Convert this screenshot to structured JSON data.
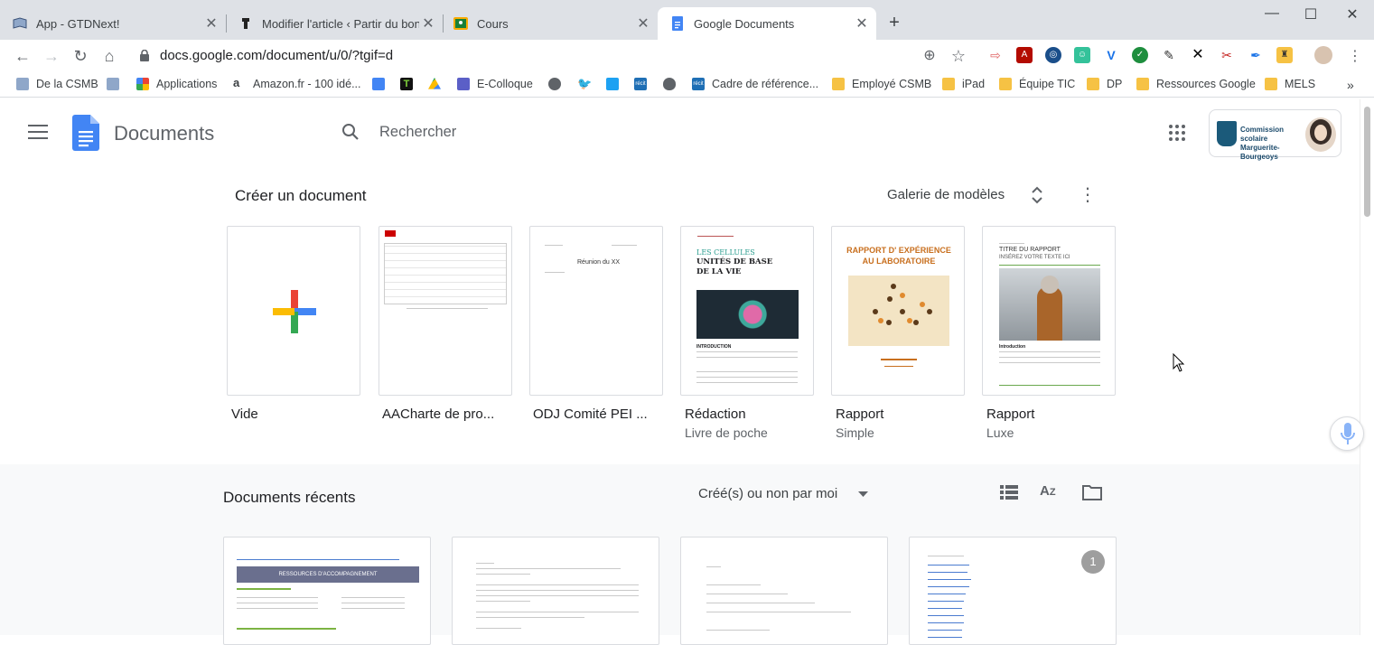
{
  "browser": {
    "tabs": [
      {
        "title": "App - GTDNext!",
        "active": false
      },
      {
        "title": "Modifier l'article ‹ Partir du bon p",
        "active": false
      },
      {
        "title": "Cours",
        "active": false
      },
      {
        "title": "Google Documents",
        "active": true
      }
    ],
    "new_tab_label": "+",
    "url": "docs.google.com/document/u/0/?tgif=d",
    "bookmarks": [
      {
        "label": "De la CSMB",
        "icon": "book-icon"
      },
      {
        "label": "",
        "icon": "book-icon"
      },
      {
        "label": "Applications",
        "icon": "apps-grid-icon"
      },
      {
        "label": "Amazon.fr - 100 idé...",
        "icon": "amazon-icon"
      },
      {
        "label": "",
        "icon": "docs-icon"
      },
      {
        "label": "",
        "icon": "t-icon"
      },
      {
        "label": "",
        "icon": "drive-icon"
      },
      {
        "label": "E-Colloque",
        "icon": "teams-icon"
      },
      {
        "label": "",
        "icon": "globe-icon"
      },
      {
        "label": "",
        "icon": "twitter-icon"
      },
      {
        "label": "",
        "icon": "chat-icon"
      },
      {
        "label": "",
        "icon": "recit-icon"
      },
      {
        "label": "",
        "icon": "apple-icon"
      },
      {
        "label": "Cadre de référence...",
        "icon": "recit-icon"
      },
      {
        "label": "Employé CSMB",
        "icon": "folder-icon"
      },
      {
        "label": "iPad",
        "icon": "folder-icon"
      },
      {
        "label": "Équipe TIC",
        "icon": "folder-icon"
      },
      {
        "label": "DP",
        "icon": "folder-icon"
      },
      {
        "label": "Ressources Google",
        "icon": "folder-icon"
      },
      {
        "label": "MELS",
        "icon": "folder-icon"
      }
    ],
    "more_bookmarks": "»"
  },
  "app": {
    "name": "Documents",
    "search_placeholder": "Rechercher",
    "org_name": "Commission scolaire Marguerite-Bourgeoys"
  },
  "templates": {
    "heading": "Créer un document",
    "gallery_label": "Galerie de modèles",
    "items": [
      {
        "title": "Vide",
        "subtitle": ""
      },
      {
        "title": "AACharte de pro...",
        "subtitle": ""
      },
      {
        "title": "ODJ Comité PEI ...",
        "subtitle": ""
      },
      {
        "title": "Rédaction",
        "subtitle": "Livre de poche"
      },
      {
        "title": "Rapport",
        "subtitle": "Simple"
      },
      {
        "title": "Rapport",
        "subtitle": "Luxe"
      }
    ],
    "thumbs": {
      "odj_heading": "Réunion du XX",
      "redaction_title1": "LES CELLULES",
      "redaction_title2": "UNITÉS DE BASE DE LA VIE",
      "redaction_intro": "INTRODUCTION",
      "rapport_simple_title": "RAPPORT D' EXPÉRIENCE AU LABORATOIRE",
      "rapport_luxe_title": "TITRE DU RAPPORT",
      "rapport_luxe_sub": "INSÉREZ VOTRE TEXTE ICI",
      "rapport_luxe_intro": "Introduction"
    }
  },
  "recent": {
    "heading": "Documents récents",
    "filter_label": "Créé(s) ou non par moi",
    "cards": [
      {
        "banner": "RESSOURCES D'ACCOMPAGNEMENT"
      },
      {
        "banner": ""
      },
      {
        "banner": ""
      },
      {
        "badge": "1"
      }
    ]
  },
  "colors": {
    "tabbar": "#dee1e6",
    "docs_blue": "#4285f4",
    "recent_bg": "#f8f9fa",
    "card_border": "#dadce0"
  }
}
